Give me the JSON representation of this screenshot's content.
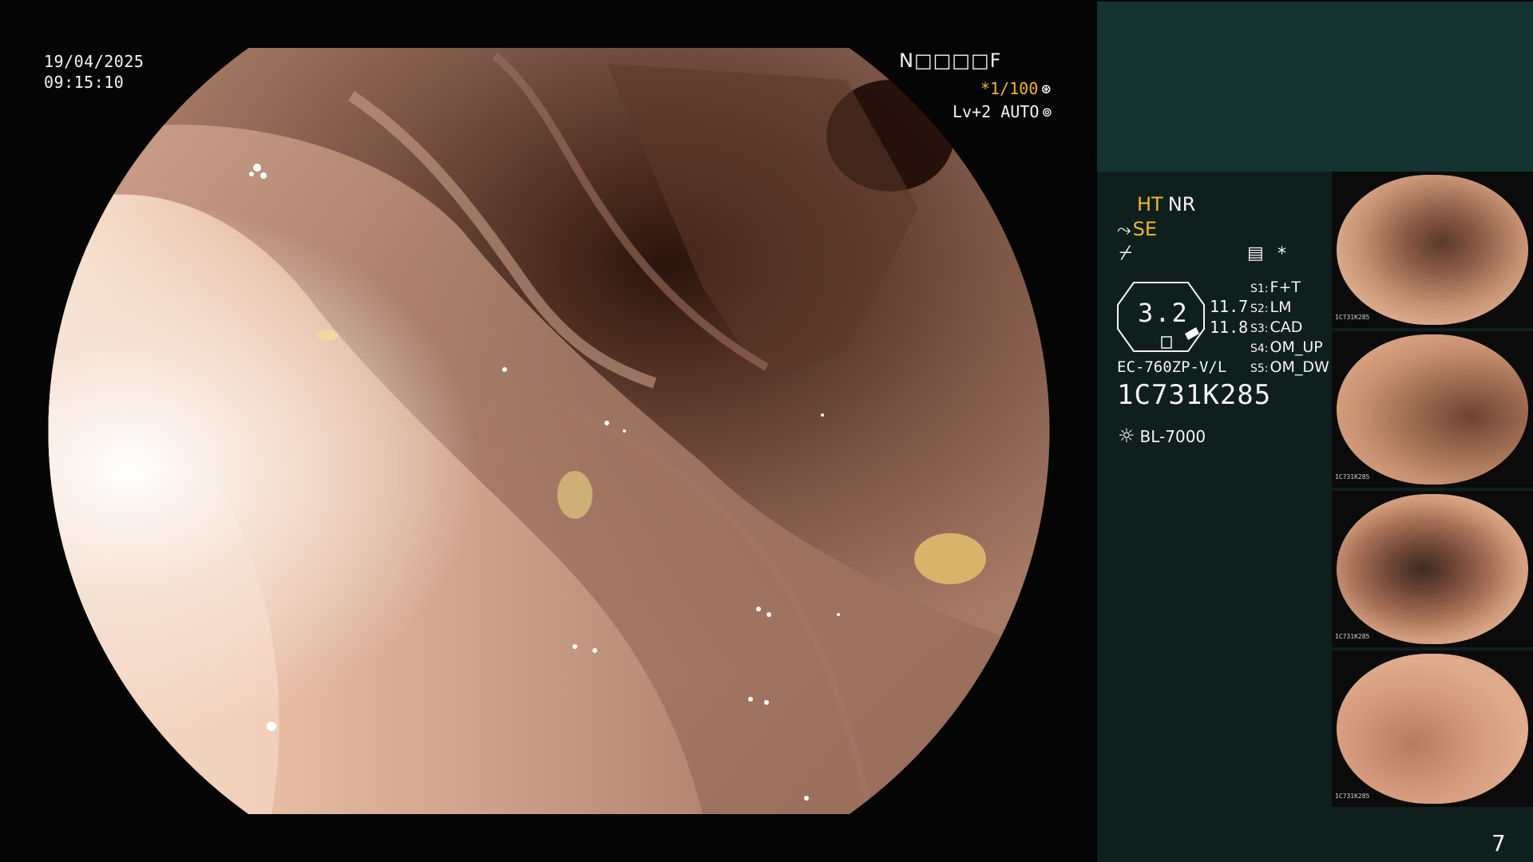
{
  "video": {
    "date": "19/04/2025",
    "time": "09:15:10",
    "patient_id": "N□□□□F",
    "shutter": "*1/100",
    "shutter_icon": "⊛",
    "iris": "Lv+2 AUTO",
    "iris_icon": "⊚"
  },
  "panel": {
    "ht": "HT",
    "nr": "NR",
    "se": "SE",
    "se_icon": "⤳",
    "fn_icon": "⌿",
    "memo_icon": "▤",
    "star": "*",
    "zoom": "3.2",
    "meas1": "11.7",
    "meas2": "11.8",
    "switches": [
      {
        "key": "S1:",
        "value": "F+T"
      },
      {
        "key": "S2:",
        "value": "LM"
      },
      {
        "key": "S3:",
        "value": "CAD"
      },
      {
        "key": "S4:",
        "value": "OM_UP"
      },
      {
        "key": "S5:",
        "value": "OM_DW"
      }
    ],
    "scope_model": "EC-760ZP-V/L",
    "serial": "1C731K285",
    "light_icon": "☼",
    "light_source": "BL-7000",
    "page": "7"
  },
  "thumbnails": [
    {
      "caption": "1C731K285"
    },
    {
      "caption": "1C731K285"
    },
    {
      "caption": "1C731K285"
    },
    {
      "caption": "1C731K285"
    }
  ],
  "colors": {
    "accent_yellow": "#f1b62f",
    "panel_top": "#143330",
    "panel": "#0f1f1d"
  }
}
